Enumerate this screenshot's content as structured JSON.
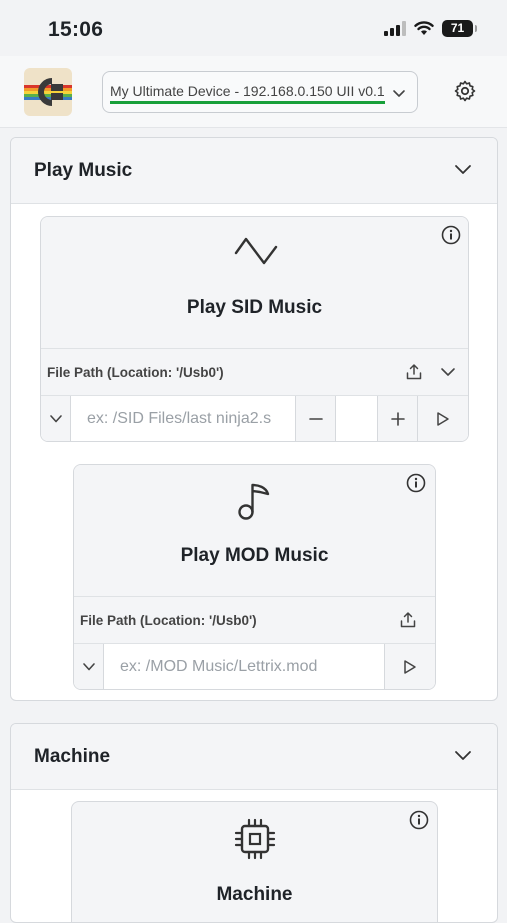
{
  "status_bar": {
    "time": "15:06",
    "battery": "71"
  },
  "header": {
    "device": "My Ultimate Device - 192.168.0.150 UII v0.1"
  },
  "play_music": {
    "title": "Play Music",
    "sid": {
      "title": "Play SID Music",
      "path_label": "File Path (Location: '/Usb0')",
      "placeholder": "ex: /SID Files/last ninja2.s"
    },
    "mod": {
      "title": "Play MOD Music",
      "path_label": "File Path (Location: '/Usb0')",
      "placeholder": "ex: /MOD Music/Lettrix.mod"
    }
  },
  "machine": {
    "title": "Machine",
    "panel_title": "Machine"
  },
  "colors": {
    "accent_underline": "#18a03a",
    "card_head": "#f4f5f7"
  },
  "icons": [
    "signal-icon",
    "wifi-icon",
    "battery-icon",
    "app-logo",
    "chevron-down-icon",
    "gear-icon",
    "info-icon",
    "waveform-icon",
    "upload-icon",
    "minus-icon",
    "plus-icon",
    "play-icon",
    "music-note-icon",
    "chip-icon"
  ]
}
